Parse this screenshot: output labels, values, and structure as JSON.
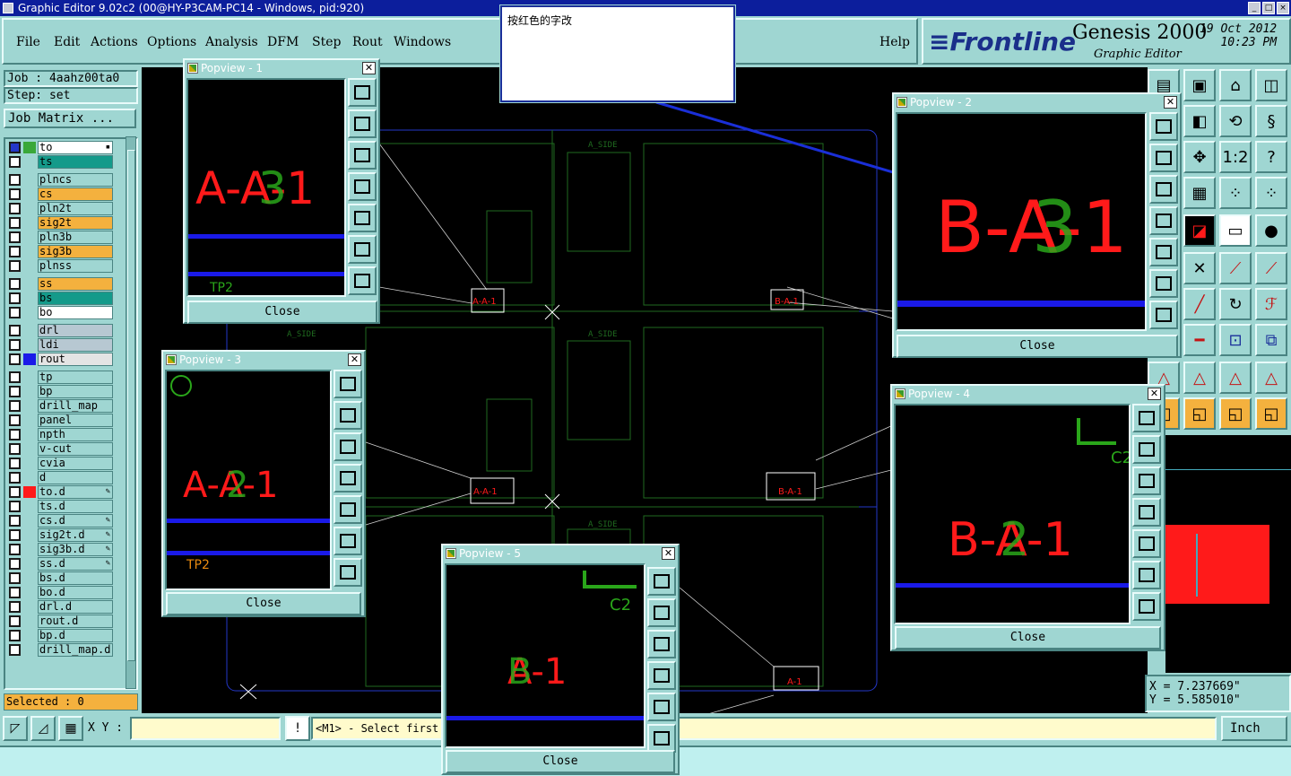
{
  "window": {
    "title": "Graphic Editor 9.02c2 (00@HY-P3CAM-PC14 - Windows, pid:920)"
  },
  "menu": {
    "items": [
      "File",
      "Edit",
      "Actions",
      "Options",
      "Analysis",
      "DFM",
      "Step",
      "Rout",
      "Windows"
    ],
    "help": "Help"
  },
  "logo": {
    "brand": "Frontline",
    "product": "Genesis 2000",
    "subtitle": "Graphic Editor",
    "date": "19 Oct 2012",
    "time": "10:23 PM"
  },
  "job": {
    "job_label": "Job : 4aahz00ta0",
    "step_label": "Step: set",
    "matrix_button": "Job Matrix ..."
  },
  "layers": [
    {
      "name": "to",
      "color": "#ffffff",
      "swatch": "#3aa83a",
      "selected": true,
      "edit": "▪"
    },
    {
      "name": "ts",
      "color": "#149a8a",
      "swatch": "",
      "selected": false,
      "edit": ""
    },
    {
      "name": "plncs",
      "color": "#9fd6d2",
      "swatch": "",
      "selected": false,
      "edit": ""
    },
    {
      "name": "cs",
      "color": "#f4b13e",
      "swatch": "",
      "selected": false,
      "edit": ""
    },
    {
      "name": "pln2t",
      "color": "#9fd6d2",
      "swatch": "",
      "selected": false,
      "edit": ""
    },
    {
      "name": "sig2t",
      "color": "#f4b13e",
      "swatch": "",
      "selected": false,
      "edit": ""
    },
    {
      "name": "pln3b",
      "color": "#9fd6d2",
      "swatch": "",
      "selected": false,
      "edit": ""
    },
    {
      "name": "sig3b",
      "color": "#f4b13e",
      "swatch": "",
      "selected": false,
      "edit": ""
    },
    {
      "name": "plnss",
      "color": "#9fd6d2",
      "swatch": "",
      "selected": false,
      "edit": ""
    },
    {
      "name": "ss",
      "color": "#f4b13e",
      "swatch": "",
      "selected": false,
      "edit": ""
    },
    {
      "name": "bs",
      "color": "#149a8a",
      "swatch": "",
      "selected": false,
      "edit": ""
    },
    {
      "name": "bo",
      "color": "#ffffff",
      "swatch": "",
      "selected": false,
      "edit": ""
    },
    {
      "name": "drl",
      "color": "#b7c8d2",
      "swatch": "",
      "selected": false,
      "edit": ""
    },
    {
      "name": "ldi",
      "color": "#b7c8d2",
      "swatch": "",
      "selected": false,
      "edit": ""
    },
    {
      "name": "rout",
      "color": "#e4e4e4",
      "swatch": "#1a1ae8",
      "selected": false,
      "edit": ""
    },
    {
      "name": "tp",
      "color": "#9fd6d2",
      "swatch": "",
      "selected": false,
      "edit": ""
    },
    {
      "name": "bp",
      "color": "#9fd6d2",
      "swatch": "",
      "selected": false,
      "edit": ""
    },
    {
      "name": "drill_map",
      "color": "#9fd6d2",
      "swatch": "",
      "selected": false,
      "edit": ""
    },
    {
      "name": "panel",
      "color": "#9fd6d2",
      "swatch": "",
      "selected": false,
      "edit": ""
    },
    {
      "name": "npth",
      "color": "#9fd6d2",
      "swatch": "",
      "selected": false,
      "edit": ""
    },
    {
      "name": "v-cut",
      "color": "#9fd6d2",
      "swatch": "",
      "selected": false,
      "edit": ""
    },
    {
      "name": "cvia",
      "color": "#9fd6d2",
      "swatch": "",
      "selected": false,
      "edit": ""
    },
    {
      "name": "d",
      "color": "#9fd6d2",
      "swatch": "",
      "selected": false,
      "edit": ""
    },
    {
      "name": "to.d",
      "color": "#9fd6d2",
      "swatch": "#ff1a1a",
      "selected": false,
      "edit": "✎"
    },
    {
      "name": "ts.d",
      "color": "#9fd6d2",
      "swatch": "",
      "selected": false,
      "edit": ""
    },
    {
      "name": "cs.d",
      "color": "#9fd6d2",
      "swatch": "",
      "selected": false,
      "edit": "✎"
    },
    {
      "name": "sig2t.d",
      "color": "#9fd6d2",
      "swatch": "",
      "selected": false,
      "edit": "✎"
    },
    {
      "name": "sig3b.d",
      "color": "#9fd6d2",
      "swatch": "",
      "selected": false,
      "edit": "✎"
    },
    {
      "name": "ss.d",
      "color": "#9fd6d2",
      "swatch": "",
      "selected": false,
      "edit": "✎"
    },
    {
      "name": "bs.d",
      "color": "#9fd6d2",
      "swatch": "",
      "selected": false,
      "edit": ""
    },
    {
      "name": "bo.d",
      "color": "#9fd6d2",
      "swatch": "",
      "selected": false,
      "edit": ""
    },
    {
      "name": "drl.d",
      "color": "#9fd6d2",
      "swatch": "",
      "selected": false,
      "edit": ""
    },
    {
      "name": "rout.d",
      "color": "#9fd6d2",
      "swatch": "",
      "selected": false,
      "edit": ""
    },
    {
      "name": "bp.d",
      "color": "#9fd6d2",
      "swatch": "",
      "selected": false,
      "edit": ""
    },
    {
      "name": "drill_map.d",
      "color": "#9fd6d2",
      "swatch": "",
      "selected": false,
      "edit": ""
    }
  ],
  "selected_label": "Selected : 0",
  "note": {
    "text": "按红色的字改"
  },
  "popviews": [
    {
      "title": "Popview - 1",
      "red": "A-A-1",
      "green": "3",
      "tp": "TP2",
      "close": "Close"
    },
    {
      "title": "Popview - 2",
      "red": "B-A-1",
      "green": "3",
      "close": "Close"
    },
    {
      "title": "Popview - 3",
      "red": "A-A-1",
      "green": "2",
      "tp": "TP2",
      "close": "Close"
    },
    {
      "title": "Popview - 4",
      "red": "B-A-1",
      "green": "2",
      "c2": "C2",
      "close": "Close"
    },
    {
      "title": "Popview - 5",
      "red": "A-1",
      "green": "B",
      "c2": "C2",
      "close": "Close"
    }
  ],
  "coords": {
    "x": "X  =  7.237669\"",
    "y": "Y  =  5.585010\""
  },
  "bottom": {
    "xy_label": "X Y :",
    "xy_value": "",
    "prompt": "<M1> - Select first",
    "units": "Inch"
  },
  "board": {
    "side_labels": [
      "A_SIDE",
      "A_SIDE",
      "A_SIDE"
    ],
    "small_labels": [
      "A-A-1",
      "B-A-1",
      "A-A-1",
      "B-A-1",
      "A-1"
    ]
  },
  "tools": {
    "ratio": "1:2",
    "help": "?"
  }
}
